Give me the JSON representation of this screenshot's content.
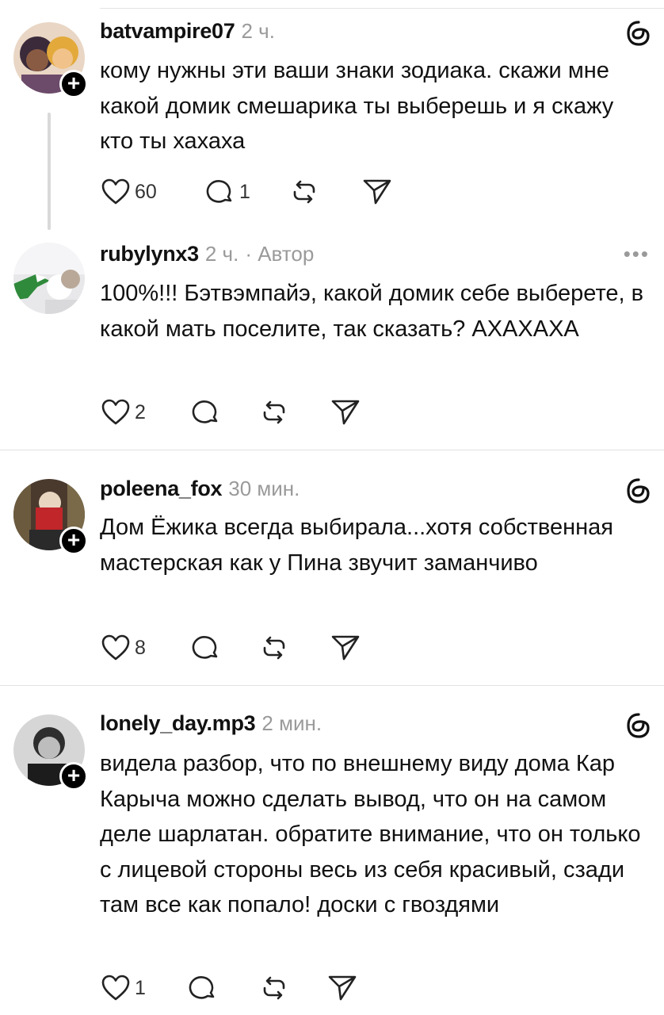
{
  "posts": [
    {
      "username": "batvampire07",
      "time": "2 ч.",
      "meta_extra": "",
      "text": "кому нужны эти ваши знаки зодиака. скажи мне какой домик смешарика ты выберешь и я скажу кто ты хахаха",
      "likes": "60",
      "replies": "1",
      "icon": "threads-logo-icon"
    },
    {
      "username": "rubylynx3",
      "time": "2 ч.",
      "meta_extra": "· Автор",
      "text": "100%!!! Бэтвэмпайэ, какой домик себе выберете, в какой мать поселите, так сказать? АХАХАХА",
      "likes": "2",
      "replies": "",
      "icon": "more-options-icon"
    },
    {
      "username": "poleena_fox",
      "time": "30 мин.",
      "meta_extra": "",
      "text": "Дом Ёжика всегда выбирала...хотя собственная мастерская как у Пина звучит заманчиво",
      "likes": "8",
      "replies": "",
      "icon": "threads-logo-icon"
    },
    {
      "username": "lonely_day.mp3",
      "time": "2 мин.",
      "meta_extra": "",
      "text": "видела разбор, что по внешнему виду дома Кар Карыча можно сделать вывод, что он на самом деле шарлатан. обратите внимание, что он только с лицевой стороны весь из себя красивый, сзади там все как попало! доски с гвоздями",
      "likes": "1",
      "replies": "",
      "icon": "threads-logo-icon"
    }
  ],
  "more_label": "•••",
  "follow_label": "+",
  "colors": {
    "text": "#111111",
    "muted": "#9a9a9a",
    "divider": "#e2e2e2",
    "thread_line": "#d9d9d9"
  }
}
